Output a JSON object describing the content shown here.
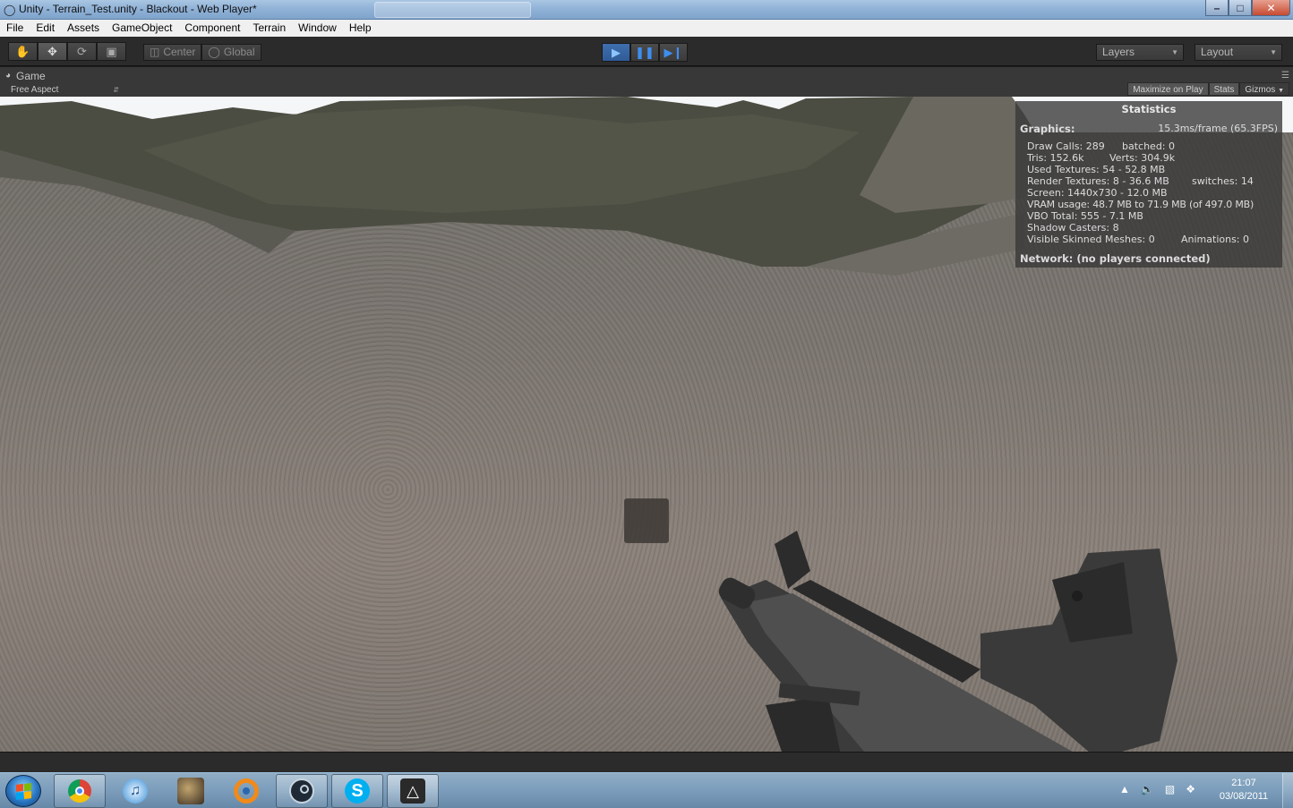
{
  "window": {
    "title": "Unity - Terrain_Test.unity - Blackout - Web Player*",
    "controls": {
      "minimize": "–",
      "maximize": "□",
      "close": "✕"
    }
  },
  "menu": [
    "File",
    "Edit",
    "Assets",
    "GameObject",
    "Component",
    "Terrain",
    "Window",
    "Help"
  ],
  "toolbar": {
    "pivot_label": "Center",
    "space_label": "Global",
    "layers_label": "Layers",
    "layout_label": "Layout",
    "tools": [
      "hand-icon",
      "move-icon",
      "rotate-icon",
      "scale-icon"
    ],
    "playback": [
      "play-icon",
      "pause-icon",
      "step-icon"
    ]
  },
  "game_view": {
    "tab_label": "Game",
    "aspect_label": "Free Aspect",
    "maximize_label": "Maximize on Play",
    "stats_label": "Stats",
    "gizmos_label": "Gizmos"
  },
  "statistics": {
    "header": "Statistics",
    "graphics_label": "Graphics:",
    "frame_time": "15.3ms/frame (65.3FPS)",
    "draw_calls": "Draw Calls: 289",
    "batched": "batched: 0",
    "tris": "Tris: 152.6k",
    "verts": "Verts: 304.9k",
    "used_textures": "Used Textures: 54 - 52.8 MB",
    "render_textures": "Render Textures: 8 - 36.6 MB",
    "switches": "switches: 14",
    "screen": "Screen: 1440x730 - 12.0 MB",
    "vram": "VRAM usage: 48.7 MB to 71.9 MB (of 497.0 MB)",
    "vbo": "VBO Total: 555 - 7.1 MB",
    "shadow_casters": "Shadow Casters: 8",
    "skinned_meshes": "Visible Skinned Meshes: 0",
    "animations": "Animations: 0",
    "network": "Network: (no players connected)"
  },
  "taskbar": {
    "apps": [
      "chrome-icon",
      "itunes-icon",
      "game-app-icon",
      "blender-icon",
      "steam-icon",
      "skype-icon",
      "unity-icon"
    ],
    "time": "21:07",
    "date": "03/08/2011"
  },
  "colors": {
    "play_active": "#3f6fae",
    "editor_dark": "#2b2b2b",
    "taskbar": "#6789a8"
  }
}
